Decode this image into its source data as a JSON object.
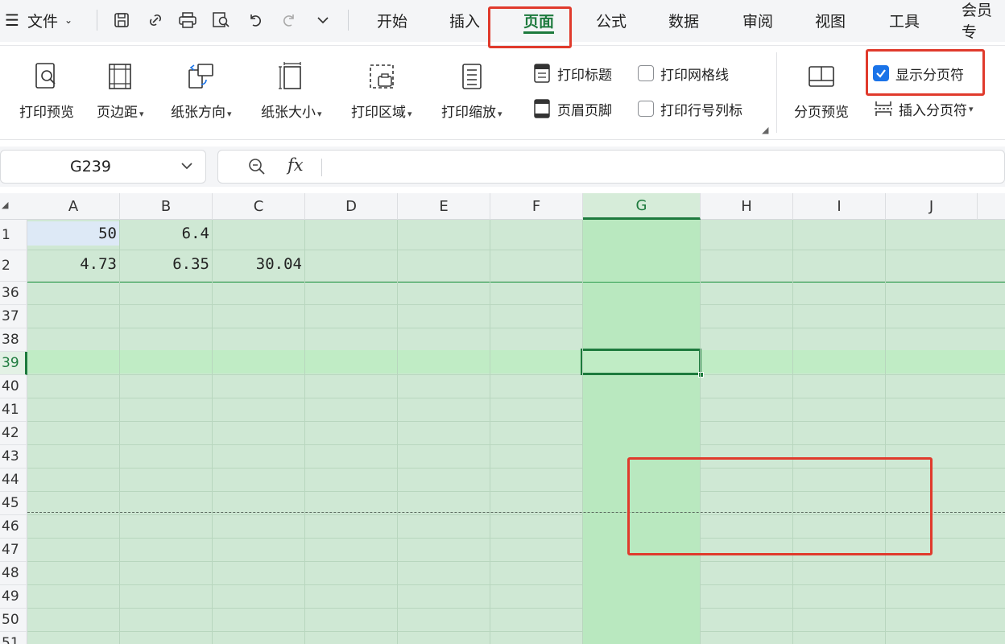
{
  "menu": {
    "menu_icon": "hamburger-icon",
    "file_label": "文件",
    "quick_icons": [
      "save-icon",
      "share-icon",
      "print-icon",
      "print-preview-icon",
      "undo-icon",
      "redo-icon",
      "more-icon"
    ]
  },
  "tabs": [
    {
      "label": "开始",
      "active": false
    },
    {
      "label": "插入",
      "active": false
    },
    {
      "label": "页面",
      "active": true
    },
    {
      "label": "公式",
      "active": false
    },
    {
      "label": "数据",
      "active": false
    },
    {
      "label": "审阅",
      "active": false
    },
    {
      "label": "视图",
      "active": false
    },
    {
      "label": "工具",
      "active": false
    },
    {
      "label": "会员专",
      "active": false
    }
  ],
  "ribbon": {
    "print_preview": "打印预览",
    "margins": "页边距",
    "orientation": "纸张方向",
    "paper_size": "纸张大小",
    "print_area": "打印区域",
    "print_scale": "打印缩放",
    "print_titles": "打印标题",
    "header_footer": "页眉页脚",
    "print_gridlines": "打印网格线",
    "print_row_col_headers": "打印行号列标",
    "page_break_preview": "分页预览",
    "show_page_breaks": "显示分页符",
    "insert_page_break": "插入分页符",
    "print_gridlines_checked": false,
    "print_row_col_headers_checked": false,
    "show_page_breaks_checked": true
  },
  "formula_bar": {
    "name_box": "G239",
    "fx_label": "fx",
    "formula": ""
  },
  "sheet": {
    "columns": [
      "A",
      "B",
      "C",
      "D",
      "E",
      "F",
      "G",
      "H",
      "I",
      "J"
    ],
    "selected_column": "G",
    "rows": [
      "1",
      "2",
      "36",
      "37",
      "38",
      "39",
      "40",
      "41",
      "42",
      "43",
      "44",
      "45",
      "46",
      "47",
      "48",
      "49",
      "50",
      "51"
    ],
    "selected_row": "39",
    "cells": {
      "A1": "50",
      "B1": "6.4",
      "A2": "4.73",
      "B2": "6.35",
      "C2": "30.04"
    }
  },
  "colors": {
    "accent_green": "#1d7a3d",
    "sheet_fill": "#cfe8d4",
    "highlight_red": "#e03a2c",
    "checkbox_blue": "#1a73e8"
  }
}
